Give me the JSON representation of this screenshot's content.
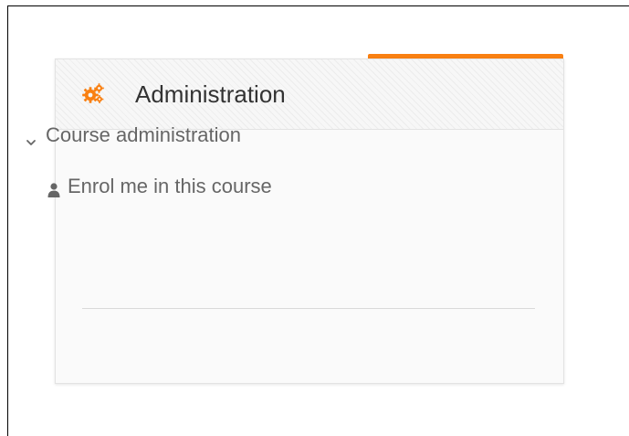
{
  "colors": {
    "accent": "#f98012",
    "title_text": "#333333",
    "item_text": "#666666"
  },
  "block": {
    "title": "Administration",
    "icon": "gears-icon"
  },
  "tree": {
    "course_admin": {
      "label": "Course administration",
      "icon": "chevron-down-icon",
      "expanded": true
    },
    "enrol": {
      "label": "Enrol me in this course",
      "icon": "user-icon"
    }
  }
}
